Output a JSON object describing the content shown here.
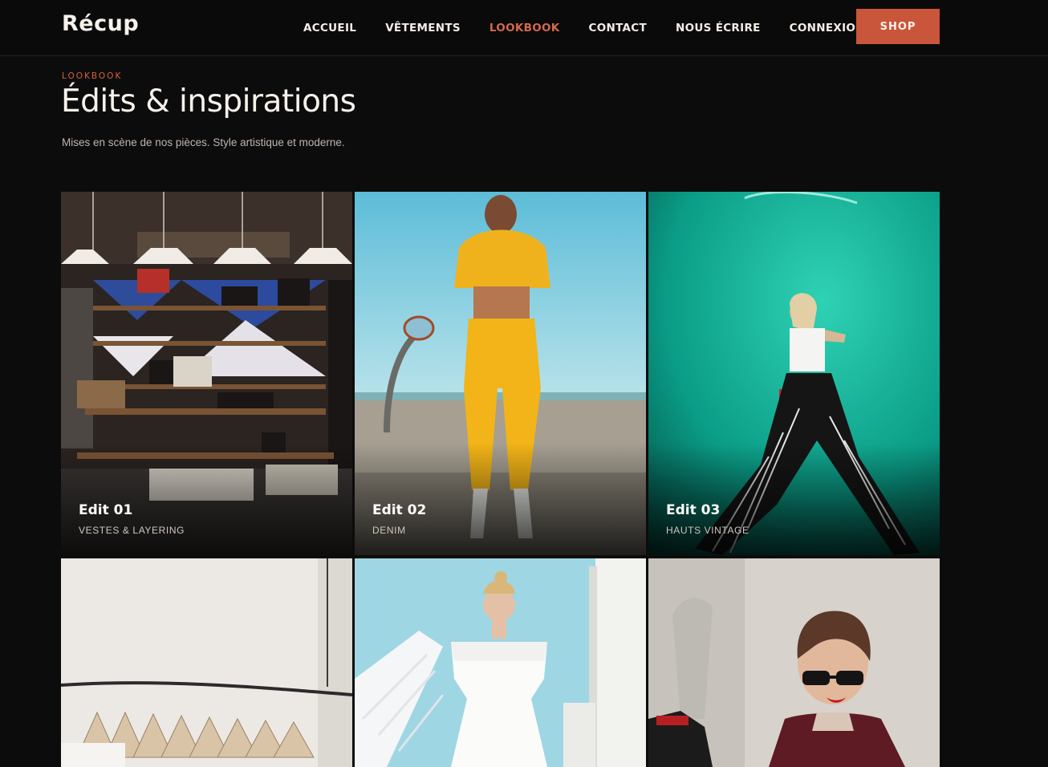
{
  "brand": {
    "name": "Récup"
  },
  "nav": {
    "items": [
      {
        "label": "ACCUEIL",
        "active": false
      },
      {
        "label": "VÊTEMENTS",
        "active": false
      },
      {
        "label": "LOOKBOOK",
        "active": true
      },
      {
        "label": "CONTACT",
        "active": false
      },
      {
        "label": "NOUS ÉCRIRE",
        "active": false
      },
      {
        "label": "CONNEXION",
        "active": false
      }
    ],
    "cta": "SHOP"
  },
  "header": {
    "eyebrow": "LOOKBOOK",
    "title": "Édits & inspirations",
    "subtitle": "Mises en scène de nos pièces. Style artistique et moderne."
  },
  "edits": [
    {
      "title": "Edit 01",
      "category": "VESTES & LAYERING",
      "scene": "boutique-shelves"
    },
    {
      "title": "Edit 02",
      "category": "DENIM",
      "scene": "yellow-tracksuit"
    },
    {
      "title": "Edit 03",
      "category": "HAUTS VINTAGE",
      "scene": "teal-neon-wall"
    },
    {
      "title": "",
      "category": "",
      "scene": "clothing-rack"
    },
    {
      "title": "",
      "category": "",
      "scene": "white-dress-stairs"
    },
    {
      "title": "",
      "category": "",
      "scene": "sunglasses-portrait"
    }
  ],
  "colors": {
    "background": "#0d0c0c",
    "accent": "#c9563a",
    "accent_text": "#d36a4a",
    "text": "#f3ede7",
    "muted": "#bdb5ad"
  }
}
